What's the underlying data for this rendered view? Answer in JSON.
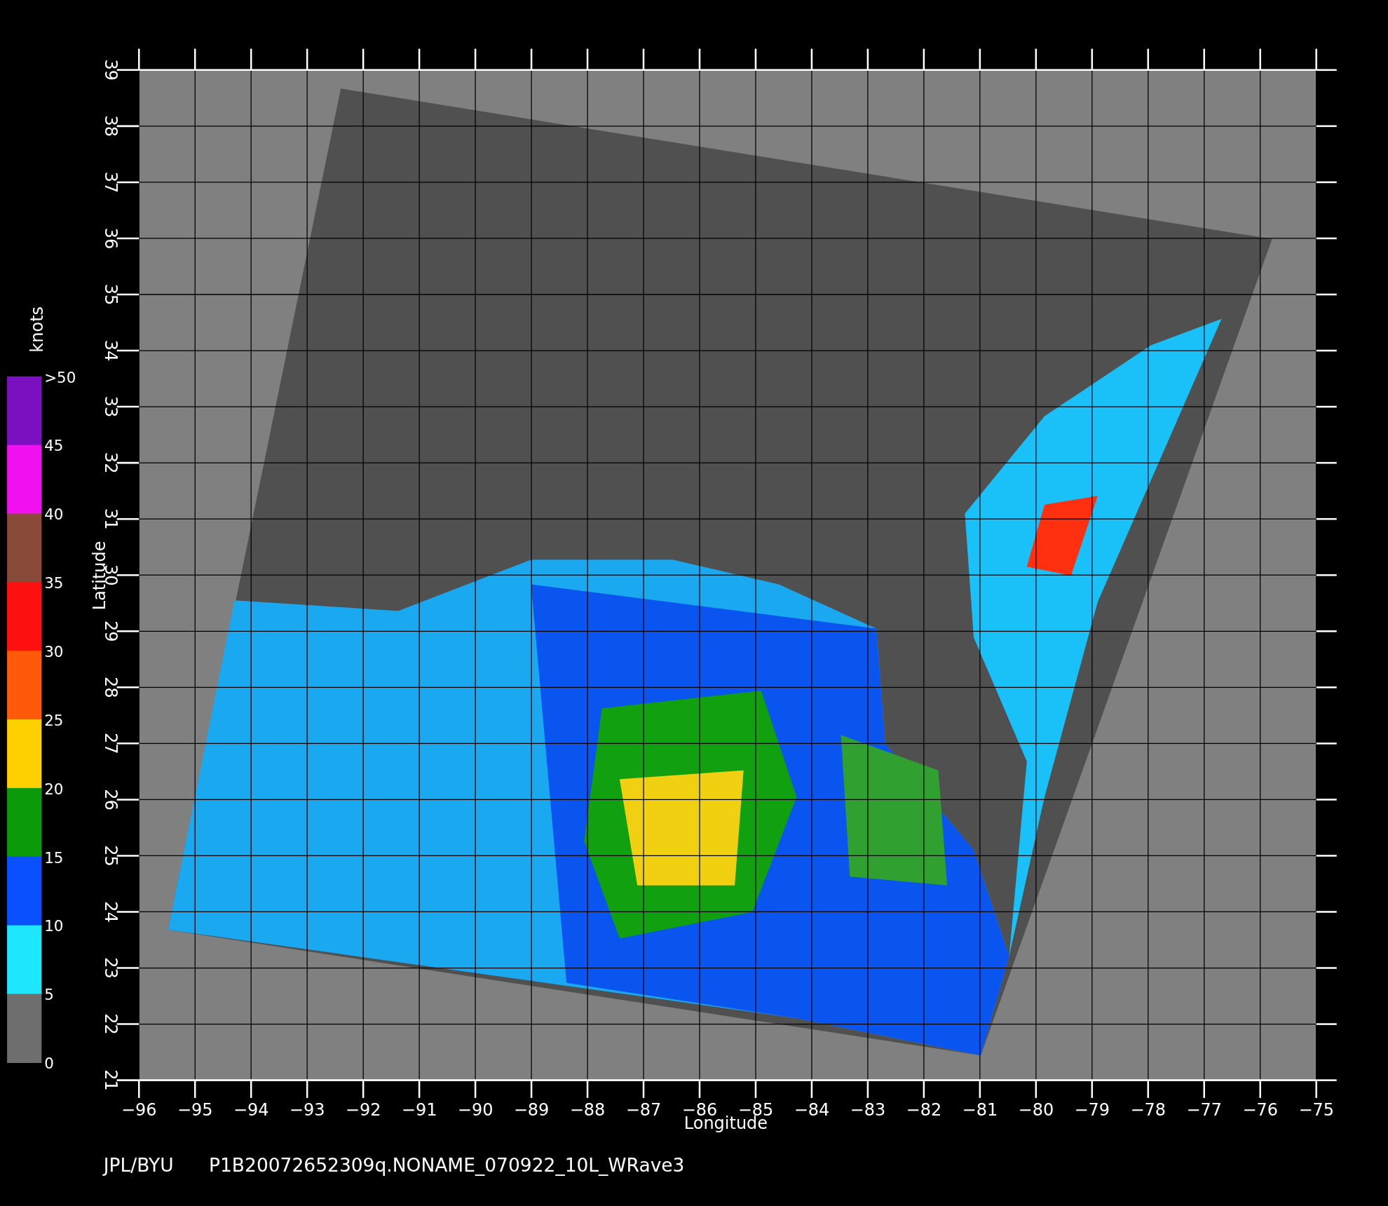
{
  "colorbar": {
    "title": "knots",
    "segments": [
      {
        "color": "#7a10c0"
      },
      {
        "color": "#f010f0"
      },
      {
        "color": "#8a4a3a"
      },
      {
        "color": "#ff1010"
      },
      {
        "color": "#ff5a0a"
      },
      {
        "color": "#ffd000"
      },
      {
        "color": "#0a9a0a"
      },
      {
        "color": "#0a50ff"
      },
      {
        "color": "#1ee6ff"
      },
      {
        "color": "#6e6e6e"
      }
    ],
    "labels": [
      ">50",
      "45",
      "40",
      "35",
      "30",
      "25",
      "20",
      "15",
      "10",
      "5",
      "0"
    ]
  },
  "plot": {
    "x_axis_title": "Longitude",
    "y_axis_title": "Latitude",
    "x_ticks": [
      "−96",
      "−95",
      "−94",
      "−93",
      "−92",
      "−91",
      "−90",
      "−89",
      "−88",
      "−87",
      "−86",
      "−85",
      "−84",
      "−83",
      "−82",
      "−81",
      "−80",
      "−79",
      "−78",
      "−77",
      "−76",
      "−75"
    ],
    "y_ticks": [
      "21",
      "22",
      "23",
      "24",
      "25",
      "26",
      "27",
      "28",
      "29",
      "30",
      "31",
      "32",
      "33",
      "34",
      "35",
      "36",
      "37",
      "38",
      "39"
    ]
  },
  "footer": {
    "source": "JPL/BYU",
    "file": "P1B20072652309q.NONAME_070922_10L_WRave3"
  }
}
